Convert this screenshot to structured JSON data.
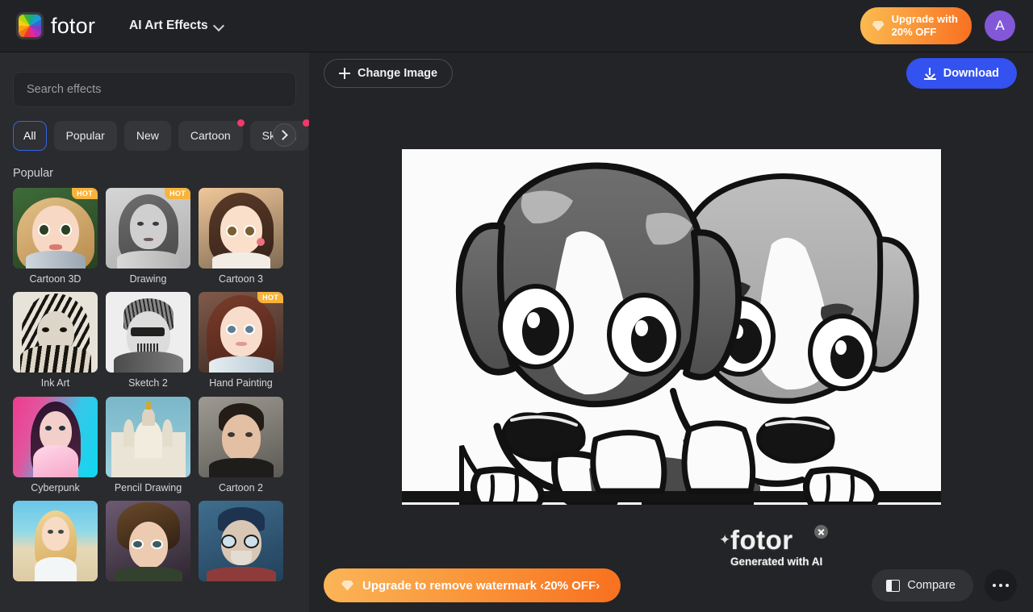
{
  "app": {
    "brand": "fotor",
    "module_title": "AI Art Effects"
  },
  "topbar": {
    "upgrade_label": "Upgrade with\n20% OFF",
    "avatar_initial": "A"
  },
  "sidebar": {
    "search_placeholder": "Search effects",
    "tabs": [
      {
        "label": "All",
        "active": true,
        "dot": false
      },
      {
        "label": "Popular",
        "active": false,
        "dot": false
      },
      {
        "label": "New",
        "active": false,
        "dot": false
      },
      {
        "label": "Cartoon",
        "active": false,
        "dot": true
      },
      {
        "label": "Sketch",
        "active": false,
        "dot": true
      }
    ],
    "section_label": "Popular",
    "effects": [
      {
        "label": "Cartoon 3D",
        "badge": "HOT"
      },
      {
        "label": "Drawing",
        "badge": "HOT"
      },
      {
        "label": "Cartoon 3",
        "badge": ""
      },
      {
        "label": "Ink Art",
        "badge": ""
      },
      {
        "label": "Sketch 2",
        "badge": ""
      },
      {
        "label": "Hand Painting",
        "badge": "HOT"
      },
      {
        "label": "Cyberpunk",
        "badge": ""
      },
      {
        "label": "Pencil Drawing",
        "badge": ""
      },
      {
        "label": "Cartoon 2",
        "badge": ""
      },
      {
        "label": "",
        "badge": ""
      },
      {
        "label": "",
        "badge": ""
      },
      {
        "label": "",
        "badge": ""
      }
    ]
  },
  "main": {
    "change_image_label": "Change Image",
    "download_label": "Download",
    "watermark_brand": "fotor",
    "watermark_sub": "Generated with AI"
  },
  "bottom": {
    "upgrade_watermark_label": "Upgrade to remove watermark ‹20% OFF›",
    "compare_label": "Compare"
  },
  "colors": {
    "accent_blue": "#3452f0",
    "upgrade_orange": "#f8701f",
    "badge_pink": "#ef3b6a",
    "hot_yellow": "#f7b33c",
    "avatar_purple": "#8358d8",
    "sidebar_bg": "#2a2b2e",
    "main_bg": "#232427",
    "topbar_bg": "#212226"
  }
}
